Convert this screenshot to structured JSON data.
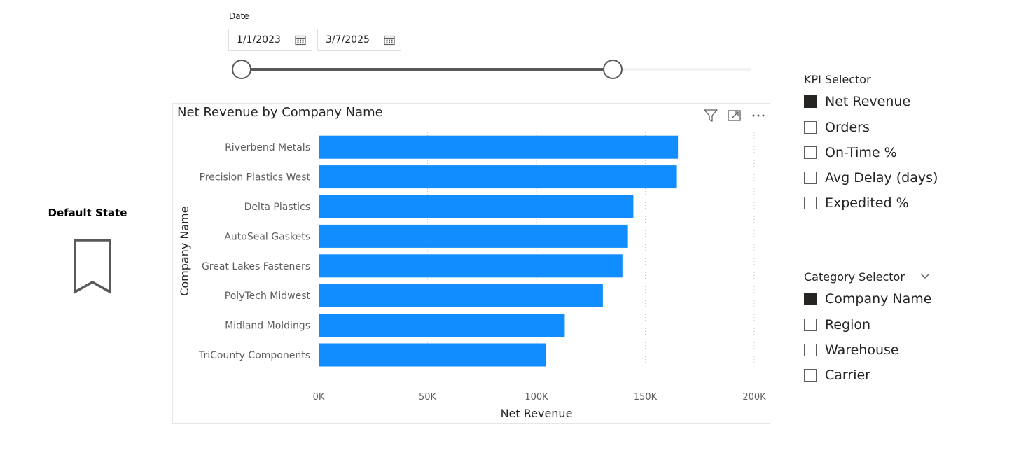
{
  "date_slicer": {
    "title": "Date",
    "start": "1/1/2023",
    "end": "3/7/2025",
    "range_fraction": [
      0.0,
      0.73
    ]
  },
  "bookmark": {
    "title": "Default State"
  },
  "visual": {
    "title": "Net Revenue by Company Name",
    "icons": [
      "filter-icon",
      "focus-mode-icon",
      "more-options-icon"
    ]
  },
  "chart_data": {
    "type": "bar",
    "orientation": "horizontal",
    "title": "Net Revenue by Company Name",
    "xlabel": "Net Revenue",
    "ylabel": "Company Name",
    "categories": [
      "Riverbend Metals",
      "Precision Plastics West",
      "Delta Plastics",
      "AutoSeal Gaskets",
      "Great Lakes Fasteners",
      "PolyTech Midwest",
      "Midland Moldings",
      "TriCounty Components"
    ],
    "values": [
      165000,
      164500,
      144500,
      142000,
      139500,
      130500,
      113000,
      104500
    ],
    "xlim": [
      0,
      200000
    ],
    "ticks": [
      "0K",
      "50K",
      "100K",
      "150K",
      "200K"
    ],
    "grid": true,
    "color": "#118DFF"
  },
  "kpi_selector": {
    "title": "KPI Selector",
    "options": [
      {
        "label": "Net Revenue",
        "checked": true
      },
      {
        "label": "Orders",
        "checked": false
      },
      {
        "label": "On-Time %",
        "checked": false
      },
      {
        "label": "Avg Delay (days)",
        "checked": false
      },
      {
        "label": "Expedited %",
        "checked": false
      }
    ]
  },
  "category_selector": {
    "title": "Category Selector",
    "options": [
      {
        "label": "Company Name",
        "checked": true
      },
      {
        "label": "Region",
        "checked": false
      },
      {
        "label": "Warehouse",
        "checked": false
      },
      {
        "label": "Carrier",
        "checked": false
      }
    ]
  }
}
